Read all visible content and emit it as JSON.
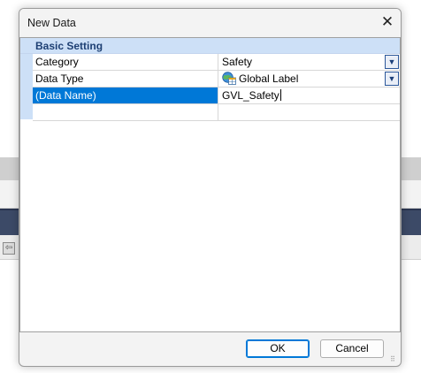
{
  "dialog": {
    "title": "New Data",
    "close_glyph": "✕"
  },
  "property_grid": {
    "category": "Basic Setting",
    "rows": [
      {
        "name": "Category",
        "value": "Safety",
        "dropdown": true
      },
      {
        "name": "Data Type",
        "value": "Global Label",
        "icon": "globe-table-icon",
        "dropdown": true
      },
      {
        "name": "(Data Name)",
        "value": "GVL_Safety",
        "selected": true,
        "editing": true
      },
      {
        "name": "",
        "value": ""
      }
    ]
  },
  "buttons": {
    "ok_label": "OK",
    "cancel_label": "Cancel"
  },
  "colors": {
    "category_band": "#cde0f7",
    "selection": "#0078d7",
    "background_navy_band": "#3c4a67"
  }
}
